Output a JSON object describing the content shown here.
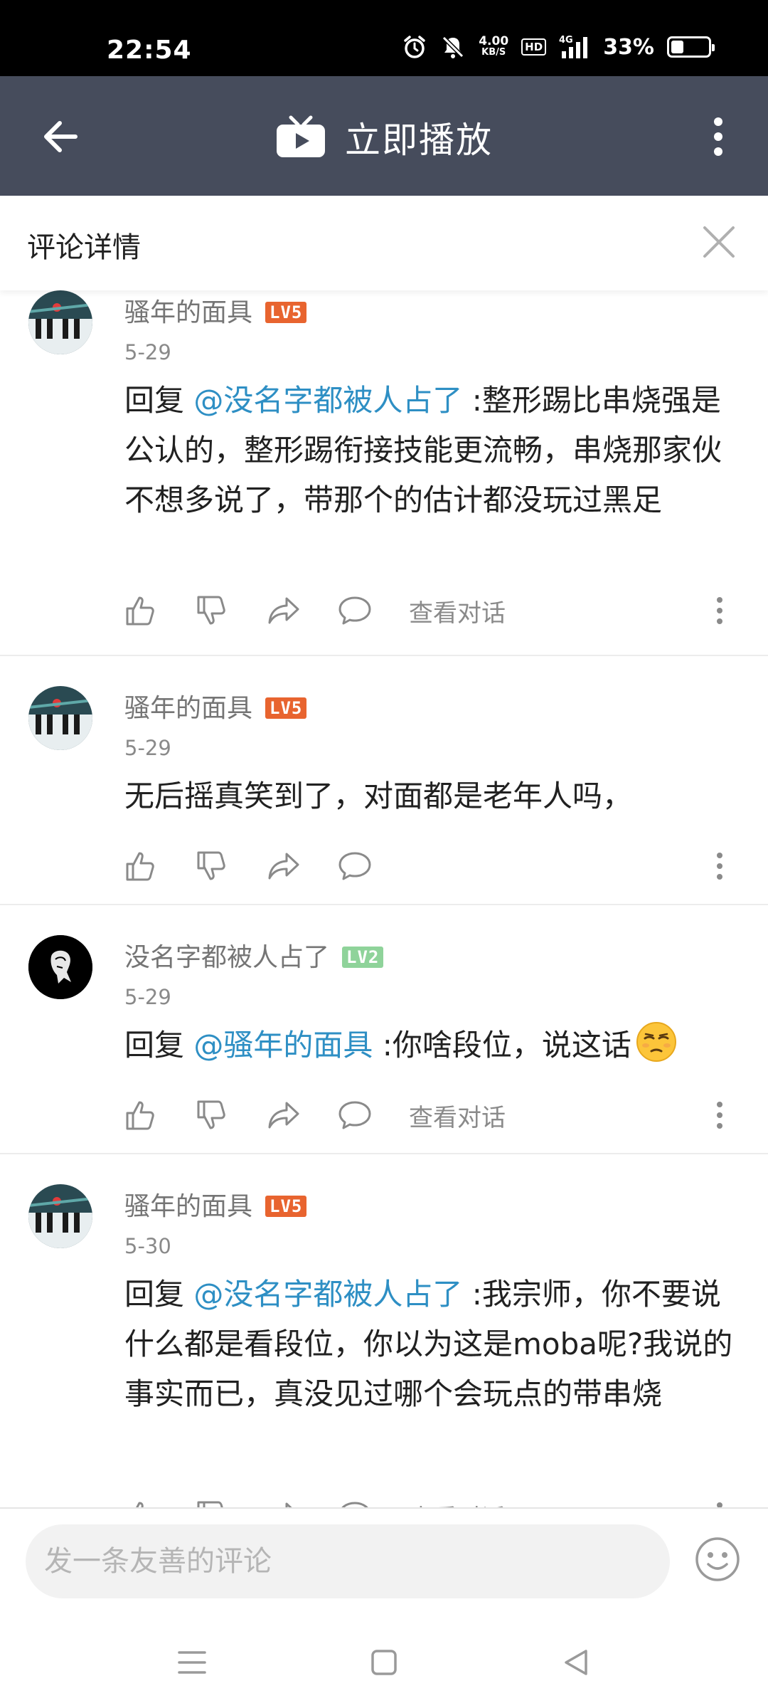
{
  "status_bar": {
    "time": "22:54",
    "net_speed_value": "4.00",
    "net_speed_unit": "KB/S",
    "hd": "HD",
    "signal": "4G",
    "battery_pct": "33%",
    "battery_level": 0.33
  },
  "app_bar": {
    "title": "立即播放"
  },
  "sub_header": {
    "title": "评论详情"
  },
  "comments": [
    {
      "username": "骚年的面具",
      "level": "LV5",
      "date": "5-29",
      "reply_prefix": "回复 ",
      "mention": "@没名字都被人占了",
      "text": " :整形踢比串烧强是公认的，整形踢衔接技能更流畅，串烧那家伙不想多说了，带那个的估计都没玩过黑足",
      "view_conversation": "查看对话"
    },
    {
      "username": "骚年的面具",
      "level": "LV5",
      "date": "5-29",
      "text": "无后摇真笑到了，对面都是老年人吗，"
    },
    {
      "username": "没名字都被人占了",
      "level": "LV2",
      "date": "5-29",
      "reply_prefix": "回复 ",
      "mention": "@骚年的面具",
      "text": " :你啥段位，说这话",
      "view_conversation": "查看对话"
    },
    {
      "username": "骚年的面具",
      "level": "LV5",
      "date": "5-30",
      "reply_prefix": "回复 ",
      "mention": "@没名字都被人占了",
      "text": " :我宗师，你不要说什么都是看段位，你以为这是moba呢?我说的事实而已，真没见过哪个会玩点的带串烧",
      "view_conversation": "查看对话"
    }
  ],
  "input": {
    "placeholder": "发一条友善的评论"
  },
  "colors": {
    "app_bar": "#464c5c",
    "mention": "#2e8fc4",
    "level5": "#e8642f",
    "level2": "#8fd39a"
  }
}
